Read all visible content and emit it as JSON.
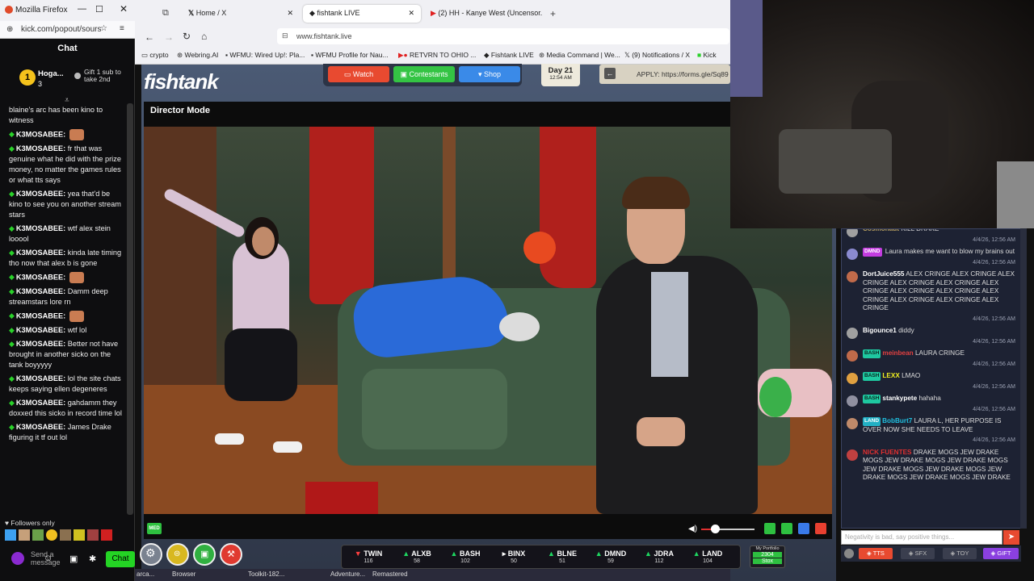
{
  "left_window": {
    "title": "Mozilla Firefox",
    "url": "kick.com/popout/sours",
    "chat_title": "Chat",
    "pinned_user": "Hoga...",
    "pinned_count": "3",
    "gift_text": "Gift 1 sub to take 2nd",
    "messages": [
      {
        "user": "",
        "text": "blaine's arc has been kino to witness"
      },
      {
        "user": "K3MOSABEE:",
        "text": "",
        "emote": true
      },
      {
        "user": "K3MOSABEE:",
        "text": "fr that was genuine what he did with the prize money, no matter the games rules or what tts says"
      },
      {
        "user": "K3MOSABEE:",
        "text": "yea that'd be kino to see you on another stream stars"
      },
      {
        "user": "K3MOSABEE:",
        "text": "wtf alex stein looool"
      },
      {
        "user": "K3MOSABEE:",
        "text": "kinda late timing tho now that alex b is gone"
      },
      {
        "user": "K3MOSABEE:",
        "text": "",
        "emote": true
      },
      {
        "user": "K3MOSABEE:",
        "text": "Damm deep streamstars lore rn"
      },
      {
        "user": "K3MOSABEE:",
        "text": "",
        "emote": true
      },
      {
        "user": "K3MOSABEE:",
        "text": "wtf lol"
      },
      {
        "user": "K3MOSABEE:",
        "text": "Better not have brought in another sicko on the tank boyyyyy"
      },
      {
        "user": "K3MOSABEE:",
        "text": "lol the site chats keeps saying ellen degeneres"
      },
      {
        "user": "K3MOSABEE:",
        "text": "gahdamm they doxxed this sicko in record time lol"
      },
      {
        "user": "K3MOSABEE:",
        "text": "James Drake figuring it tf out lol"
      }
    ],
    "followers_only": "Followers only",
    "send_placeholder": "Send a message",
    "chat_button": "Chat"
  },
  "tabs": [
    {
      "label": "Home / X"
    },
    {
      "label": "fishtank LIVE"
    },
    {
      "label": "(2) HH - Kanye West (Uncensor..."
    }
  ],
  "address": "www.fishtank.live",
  "bookmarks": [
    "crypto",
    "Webring.AI",
    "WFMU: Wired Up!: Pla...",
    "WFMU Profile for Nau...",
    "RETVRN TO OHIO ...",
    "Fishtank LIVE",
    "Media Command | We...",
    "(9) Notifications / X",
    "Kick"
  ],
  "site": {
    "logo": "fishtank",
    "nav": {
      "watch": "Watch",
      "contestants": "Contestants",
      "shop": "Shop"
    },
    "day": "Day 21",
    "time": "12:54 AM",
    "apply": "APPLY: https://forms.gle/Sq89",
    "director_mode": "Director Mode",
    "med_label": "MED",
    "ticker": [
      {
        "code": "TWIN",
        "sub": "116",
        "dir": "down"
      },
      {
        "code": "ALXB",
        "sub": "58",
        "dir": "up"
      },
      {
        "code": "BASH",
        "sub": "102",
        "dir": "up"
      },
      {
        "code": "BINX",
        "sub": "50",
        "dir": "flat"
      },
      {
        "code": "BLNE",
        "sub": "51",
        "dir": "up"
      },
      {
        "code": "DMND",
        "sub": "59",
        "dir": "up"
      },
      {
        "code": "JDRA",
        "sub": "112",
        "dir": "up"
      },
      {
        "code": "LAND",
        "sub": "104",
        "dir": "up"
      }
    ],
    "portfolio_label": "My Portfolio",
    "portfolio_value": "2304",
    "portfolio_action": "Stox"
  },
  "fish_chat": {
    "messages": [
      {
        "user": "Cosmonaut",
        "badge": "",
        "text": "KILL DRAKE",
        "time": "4/4/26, 12:56 AM"
      },
      {
        "user": "",
        "badge": "DMND",
        "text": "Laura makes me want to blow my brains out",
        "time": "4/4/26, 12:56 AM"
      },
      {
        "user": "DortJuice555",
        "badge": "",
        "text": "ALEX CRINGE ALEX CRINGE ALEX CRINGE ALEX CRINGE ALEX CRINGE ALEX CRINGE ALEX CRINGE ALEX CRINGE ALEX CRINGE ALEX CRINGE ALEX CRINGE ALEX CRINGE",
        "time": "4/4/26, 12:56 AM"
      },
      {
        "user": "Bigounce1",
        "badge": "",
        "text": "diddy",
        "time": "4/4/26, 12:56 AM"
      },
      {
        "user": "meinbean",
        "badge": "BASH",
        "text": "LAURA CRINGE",
        "time": "4/4/26, 12:56 AM"
      },
      {
        "user": "LEXX",
        "badge": "BASH",
        "text": "LMAO",
        "time": "4/4/26, 12:56 AM"
      },
      {
        "user": "stankypete",
        "badge": "BASH",
        "text": "hahaha",
        "time": "4/4/26, 12:56 AM"
      },
      {
        "user": "BobBurt7",
        "badge": "LAND",
        "text": "LAURA L, HER PURPOSE IS OVER NOW SHE NEEDS TO LEAVE",
        "time": "4/4/26, 12:56 AM"
      },
      {
        "user": "NICK FUENTES",
        "badge": "",
        "text": "DRAKE MOGS JEW DRAKE MOGS JEW DRAKE MOGS JEW DRAKE MOGS JEW DRAKE MOGS JEW DRAKE MOGS JEW DRAKE MOGS JEW DRAKE MOGS JEW DRAKE",
        "time": ""
      }
    ],
    "input_placeholder": "Negativity is bad, say positive things...",
    "buttons": {
      "tts": "TTS",
      "sfx": "SFX",
      "toy": "TOY",
      "gift": "GIFT"
    }
  },
  "taskbar": [
    "arca...",
    "Browser",
    "Toolkit-182...",
    "Adventure...",
    "Remastered"
  ]
}
